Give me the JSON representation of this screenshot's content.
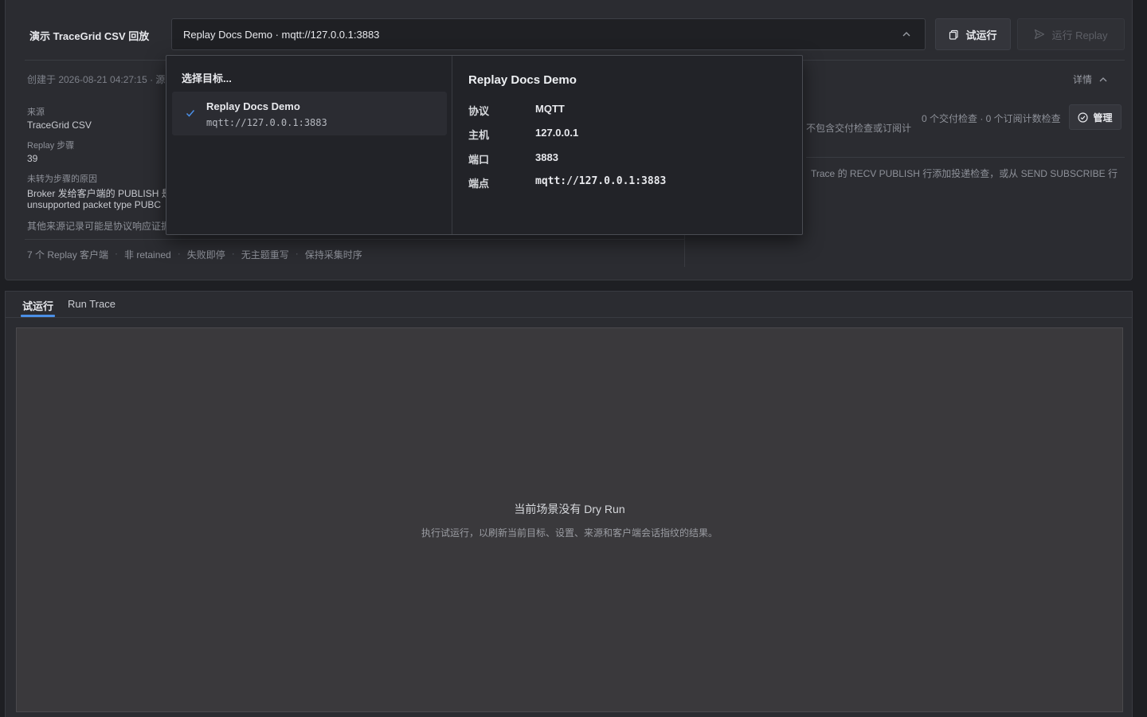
{
  "header": {
    "scenario_title": "演示 TraceGrid CSV 回放",
    "target_select_value": "Replay Docs Demo · mqtt://127.0.0.1:3883",
    "dry_run_label": "试运行",
    "run_replay_label": "运行 Replay"
  },
  "meta": {
    "created_line": "创建于 2026-08-21 04:27:15 · 源",
    "details_label": "详情"
  },
  "source_info": {
    "source_label": "来源",
    "source_value": "TraceGrid CSV",
    "steps_label": "Replay 步骤",
    "steps_value": "39",
    "reason_label": "未转为步骤的原因",
    "reason_lines": [
      "Broker 发给客户端的 PUBLISH 是",
      "unsupported packet type PUBC"
    ],
    "note": "其他来源记录可能是协议响应证据"
  },
  "tags": [
    "7 个 Replay 客户端",
    "非 retained",
    "失败即停",
    "无主题重写",
    "保持采集时序"
  ],
  "checks": {
    "summary": "0 个交付检查 · 0 个订阅计数检查",
    "manage_label": "管理",
    "partial_text_1": "不包含交付检查或订阅计",
    "partial_text_2": "Trace 的 RECV PUBLISH 行添加投递检查，或从 SEND SUBSCRIBE 行"
  },
  "tabs": [
    {
      "label": "试运行",
      "active": true
    },
    {
      "label": "Run Trace",
      "active": false
    }
  ],
  "empty_state": {
    "title": "当前场景没有 Dry Run",
    "description": "执行试运行，以刷新当前目标、设置、来源和客户端会话指纹的结果。"
  },
  "dropdown": {
    "heading": "选择目标...",
    "options": [
      {
        "name": "Replay Docs Demo",
        "url": "mqtt://127.0.0.1:3883",
        "selected": true
      }
    ],
    "detail": {
      "title": "Replay Docs Demo",
      "rows": [
        {
          "key": "协议",
          "value": "MQTT"
        },
        {
          "key": "主机",
          "value": "127.0.0.1"
        },
        {
          "key": "端口",
          "value": "3883"
        },
        {
          "key": "端点",
          "value": "mqtt://127.0.0.1:3883"
        }
      ]
    }
  },
  "colors": {
    "accent": "#4b8fe6",
    "background": "#1e1f23",
    "panel": "#2b2c31"
  }
}
